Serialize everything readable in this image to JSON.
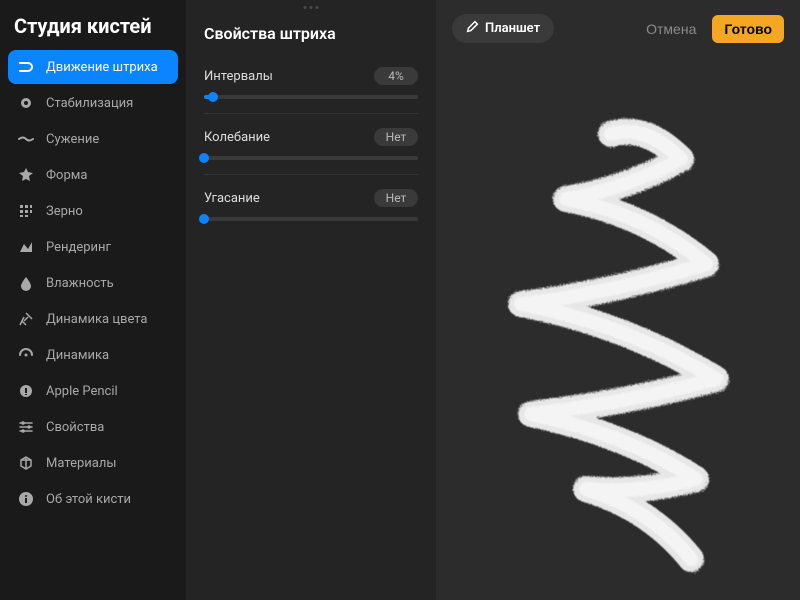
{
  "sidebar": {
    "title": "Студия кистей",
    "items": [
      {
        "label": "Движение штриха",
        "icon": "stroke-path-icon"
      },
      {
        "label": "Стабилизация",
        "icon": "stabilization-icon"
      },
      {
        "label": "Сужение",
        "icon": "taper-icon"
      },
      {
        "label": "Форма",
        "icon": "shape-icon"
      },
      {
        "label": "Зерно",
        "icon": "grain-icon"
      },
      {
        "label": "Рендеринг",
        "icon": "rendering-icon"
      },
      {
        "label": "Влажность",
        "icon": "wet-mix-icon"
      },
      {
        "label": "Динамика цвета",
        "icon": "color-dynamics-icon"
      },
      {
        "label": "Динамика",
        "icon": "dynamics-icon"
      },
      {
        "label": "Apple Pencil",
        "icon": "apple-pencil-icon"
      },
      {
        "label": "Свойства",
        "icon": "properties-icon"
      },
      {
        "label": "Материалы",
        "icon": "materials-icon"
      },
      {
        "label": "Об этой кисти",
        "icon": "about-icon"
      }
    ],
    "activeIndex": 0
  },
  "panel": {
    "title": "Свойства штриха",
    "sliders": [
      {
        "label": "Интервалы",
        "value_text": "4%",
        "fill_pct": 4
      },
      {
        "label": "Колебание",
        "value_text": "Нет",
        "fill_pct": 0
      },
      {
        "label": "Угасание",
        "value_text": "Нет",
        "fill_pct": 0
      }
    ]
  },
  "preview": {
    "tab_label": "Планшет",
    "cancel_label": "Отмена",
    "done_label": "Готово"
  },
  "colors": {
    "accent": "#0a84ff",
    "done_button": "#f5a623"
  }
}
